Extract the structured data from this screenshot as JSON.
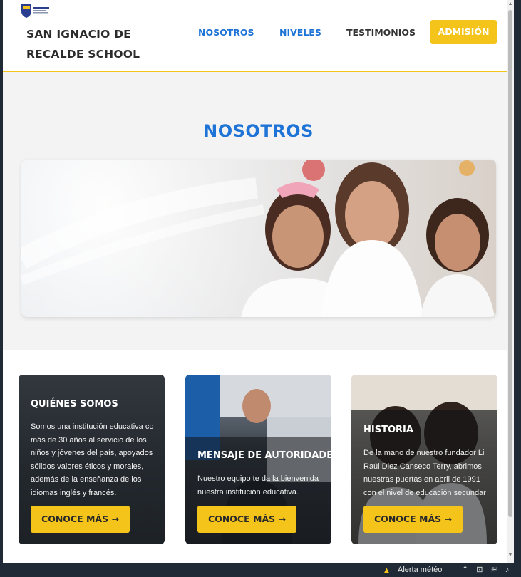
{
  "header": {
    "site_name": "SAN IGNACIO DE RECALDE SCHOOL",
    "nav": [
      "NOSOTROS",
      "NIVELES",
      "TESTIMONIOS"
    ],
    "admision": "ADMISIÓN"
  },
  "hero": {
    "title": "NOSOTROS"
  },
  "cards": [
    {
      "title": "QUIÉNES SOMOS",
      "text": "Somos una institución educativa co\nmás de 30 años al servicio de los\nniños y jóvenes del país, apoyados\nsólidos valores éticos y morales,\nademás de la enseñanza de los\nidiomas inglés y francés.",
      "button": "CONOCE MÁS →"
    },
    {
      "title": "MENSAJE DE AUTORIDADE",
      "text": "Nuestro equipo te da la bienvenida\nnuestra institución educativa.",
      "button": "CONOCE MÁS →"
    },
    {
      "title": "HISTORIA",
      "text": "De la mano de nuestro fundador Li\nRaúl Diez Canseco Terry, abrimos\nnuestras puertas en abril de 1991\ncon el nivel de educación secundar",
      "button": "CONOCE MÁS →"
    }
  ],
  "taskbar": {
    "alert": "Alerta météo",
    "icons": [
      "warning-icon",
      "chevron-up-icon",
      "network-icon",
      "wifi-icon",
      "speaker-icon"
    ]
  },
  "colors": {
    "accent_yellow": "#f5c41a",
    "nav_blue": "#1e73d6"
  }
}
